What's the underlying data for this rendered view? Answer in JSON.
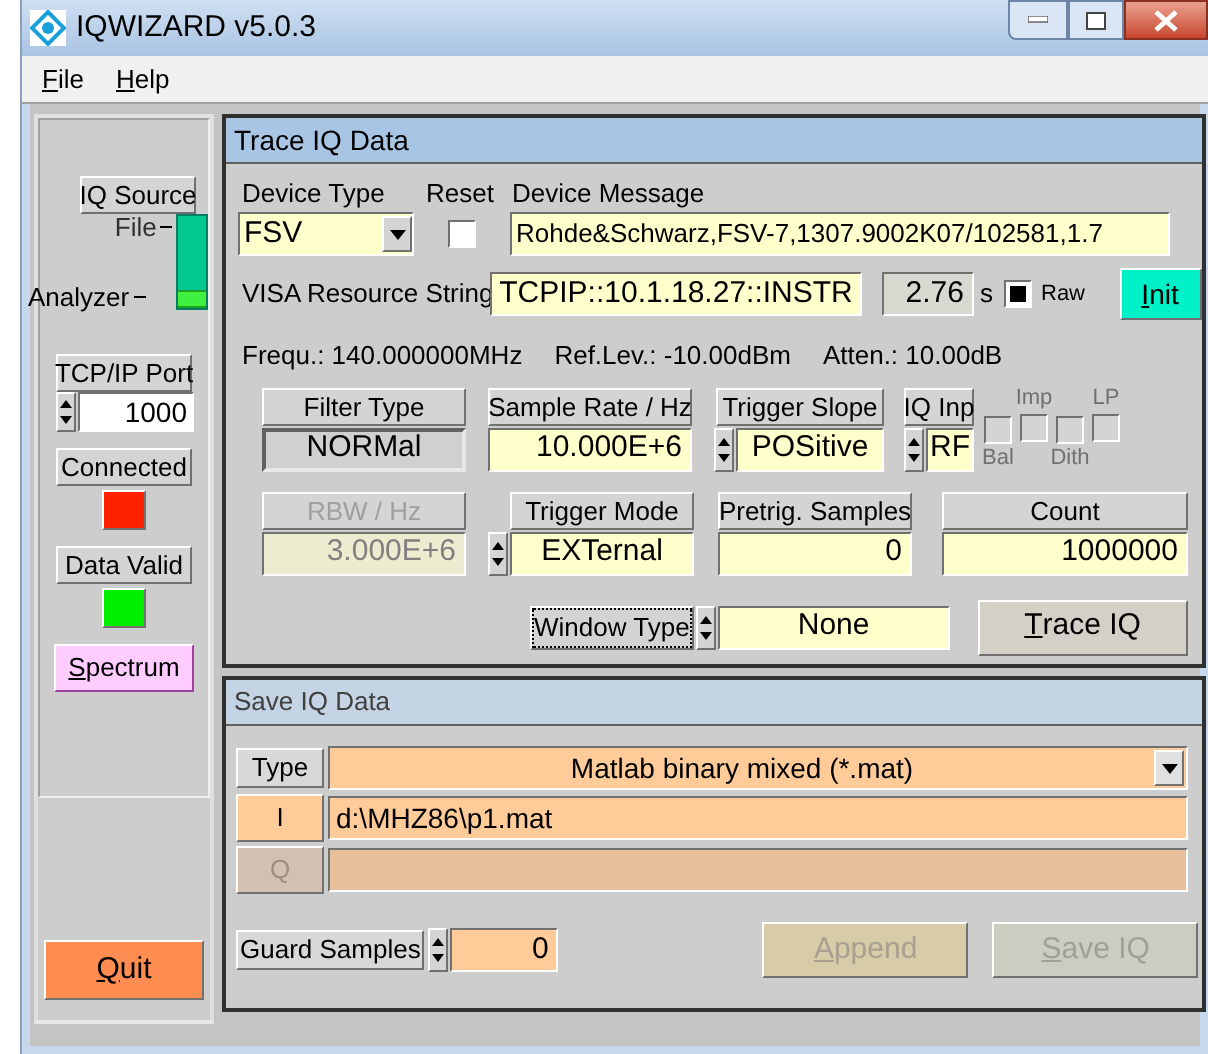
{
  "window": {
    "title": "IQWIZARD v5.0.3"
  },
  "menu": [
    {
      "label": "File",
      "mnemonic": true
    },
    {
      "label": "Help",
      "mnemonic": true
    }
  ],
  "source_panel": {
    "iq_source": {
      "label": "IQ Source",
      "options": [
        {
          "label": "File",
          "selected": false
        },
        {
          "label": "Analyzer",
          "selected": true
        }
      ]
    },
    "tcp_port": {
      "label": "TCP/IP Port",
      "value": "1000"
    },
    "indicators": [
      {
        "label": "Connected",
        "color": "#ff2200"
      },
      {
        "label": "Data Valid",
        "color": "#00ee00"
      }
    ],
    "spectrum_button": {
      "label": "Spectrum",
      "mnemonic": true
    },
    "quit_button": {
      "label": "Quit",
      "mnemonic": true
    }
  },
  "trace_panel": {
    "title": "Trace IQ Data",
    "device_type": {
      "label": "Device Type",
      "value": "FSV"
    },
    "reset": {
      "label": "Reset",
      "checked": false
    },
    "device_message": {
      "label": "Device Message",
      "value": "Rohde&Schwarz,FSV-7,1307.9002K07/102581,1.7"
    },
    "visa": {
      "label": "VISA Resource String",
      "value": "TCPIP::10.1.18.27::INSTR"
    },
    "timeout": {
      "value": "2.76",
      "unit": "s"
    },
    "raw": {
      "label": "Raw",
      "checked": true
    },
    "init_button": {
      "label": "Init",
      "mnemonic": true
    },
    "status": [
      "Frequ.: 140.000000MHz",
      "Ref.Lev.: -10.00dBm",
      "Atten.: 10.00dB"
    ],
    "filter_type": {
      "label": "Filter Type",
      "value": "NORMal"
    },
    "sample_rate": {
      "label": "Sample Rate / Hz",
      "value": "10.000E+6"
    },
    "trigger_slope": {
      "label": "Trigger Slope",
      "value": "POSitive"
    },
    "iq_input": {
      "label": "IQ Inp",
      "value": "RF"
    },
    "options": [
      {
        "label": "Bal",
        "checked": false,
        "disabled": true
      },
      {
        "label": "Imp",
        "checked": false,
        "disabled": true
      },
      {
        "label": "Dith",
        "checked": false,
        "disabled": true
      },
      {
        "label": "LP",
        "checked": false,
        "disabled": true
      }
    ],
    "rbw": {
      "label": "RBW / Hz",
      "value": "3.000E+6",
      "disabled": true
    },
    "trigger_mode": {
      "label": "Trigger Mode",
      "value": "EXTernal"
    },
    "pretrigger": {
      "label": "Pretrig. Samples",
      "value": "0"
    },
    "count": {
      "label": "Count",
      "value": "1000000"
    },
    "window_type": {
      "label": "Window Type",
      "value": "None",
      "focused": true
    },
    "trace_button": {
      "label": "Trace IQ",
      "mnemonic": true
    }
  },
  "save_panel": {
    "title": "Save IQ Data",
    "type": {
      "label": "Type",
      "value": "Matlab binary mixed (*.mat)"
    },
    "i_file": {
      "label": "I",
      "value": "d:\\MHZ86\\p1.mat",
      "disabled": false
    },
    "q_file": {
      "label": "Q",
      "disabled": true
    },
    "guard_samples": {
      "label": "Guard Samples",
      "value": "0"
    },
    "append_button": {
      "label": "Append",
      "mnemonic": true,
      "disabled": true
    },
    "save_button": {
      "label": "Save IQ",
      "mnemonic": true,
      "disabled": true
    }
  }
}
